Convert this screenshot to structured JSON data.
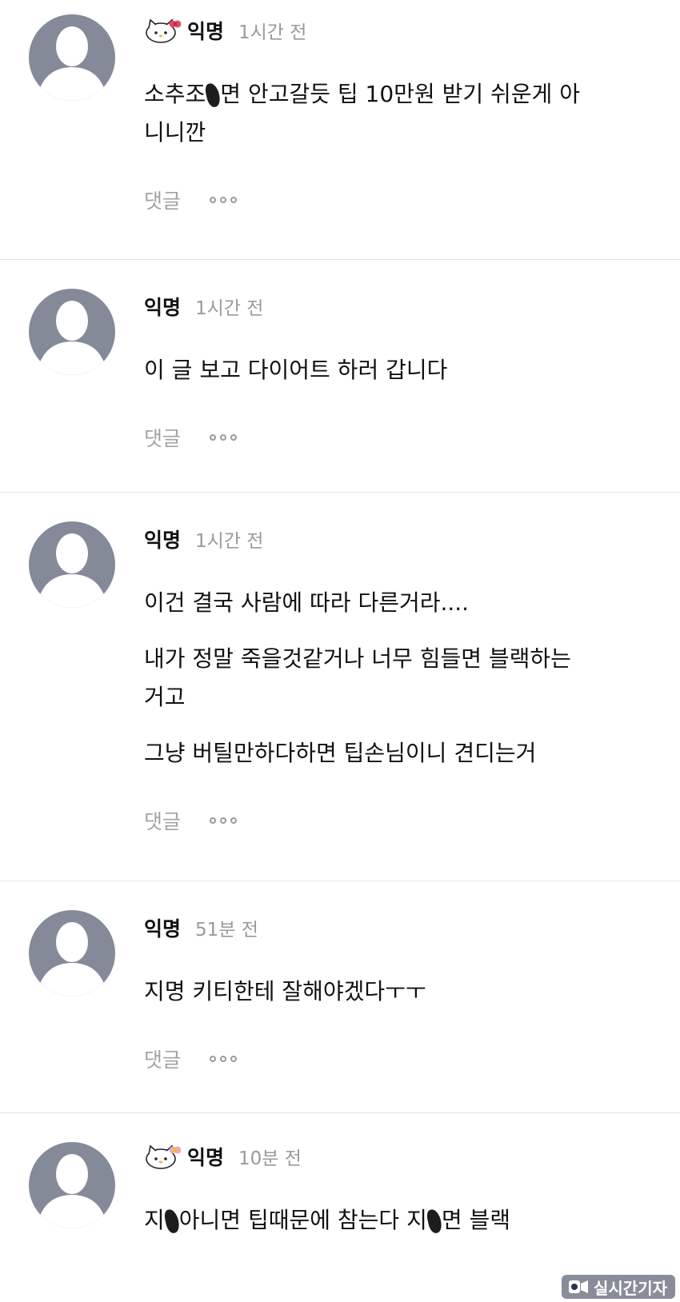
{
  "comments": [
    {
      "author": "익명",
      "time": "1시간 전",
      "badge": "hello-kitty-badge",
      "lines": [
        "소추조",
        "면 안고갈듯 팁 10만원 받기 쉬운게 아",
        "니니깐"
      ],
      "reply_label": "댓글"
    },
    {
      "author": "익명",
      "time": "1시간 전",
      "lines": [
        "이 글 보고 다이어트 하러 갑니다"
      ],
      "reply_label": "댓글"
    },
    {
      "author": "익명",
      "time": "1시간 전",
      "lines": [
        "이건 결국 사람에 따라 다른거라....",
        "내가 정말 죽을것같거나 너무 힘들면 블랙하는",
        "거고",
        "그냥 버틸만하다하면 팁손님이니 견디는거"
      ],
      "reply_label": "댓글"
    },
    {
      "author": "익명",
      "time": "51분 전",
      "lines": [
        "지명 키티한테 잘해야겠다ㅜㅜ"
      ],
      "reply_label": "댓글"
    },
    {
      "author": "익명",
      "time": "10분 전",
      "badge": "hello-kitty-badge",
      "lines": [
        "지",
        "아니면 팁때문에 참는다 지",
        "면 블랙"
      ],
      "reply_label": "댓글"
    }
  ],
  "watermark": {
    "text": "실시간기자",
    "icon": "reporter-logo-icon"
  },
  "colors": {
    "avatar": "#858a98",
    "timestamp": "#9a9a9a",
    "divider": "#e4e4e4"
  }
}
